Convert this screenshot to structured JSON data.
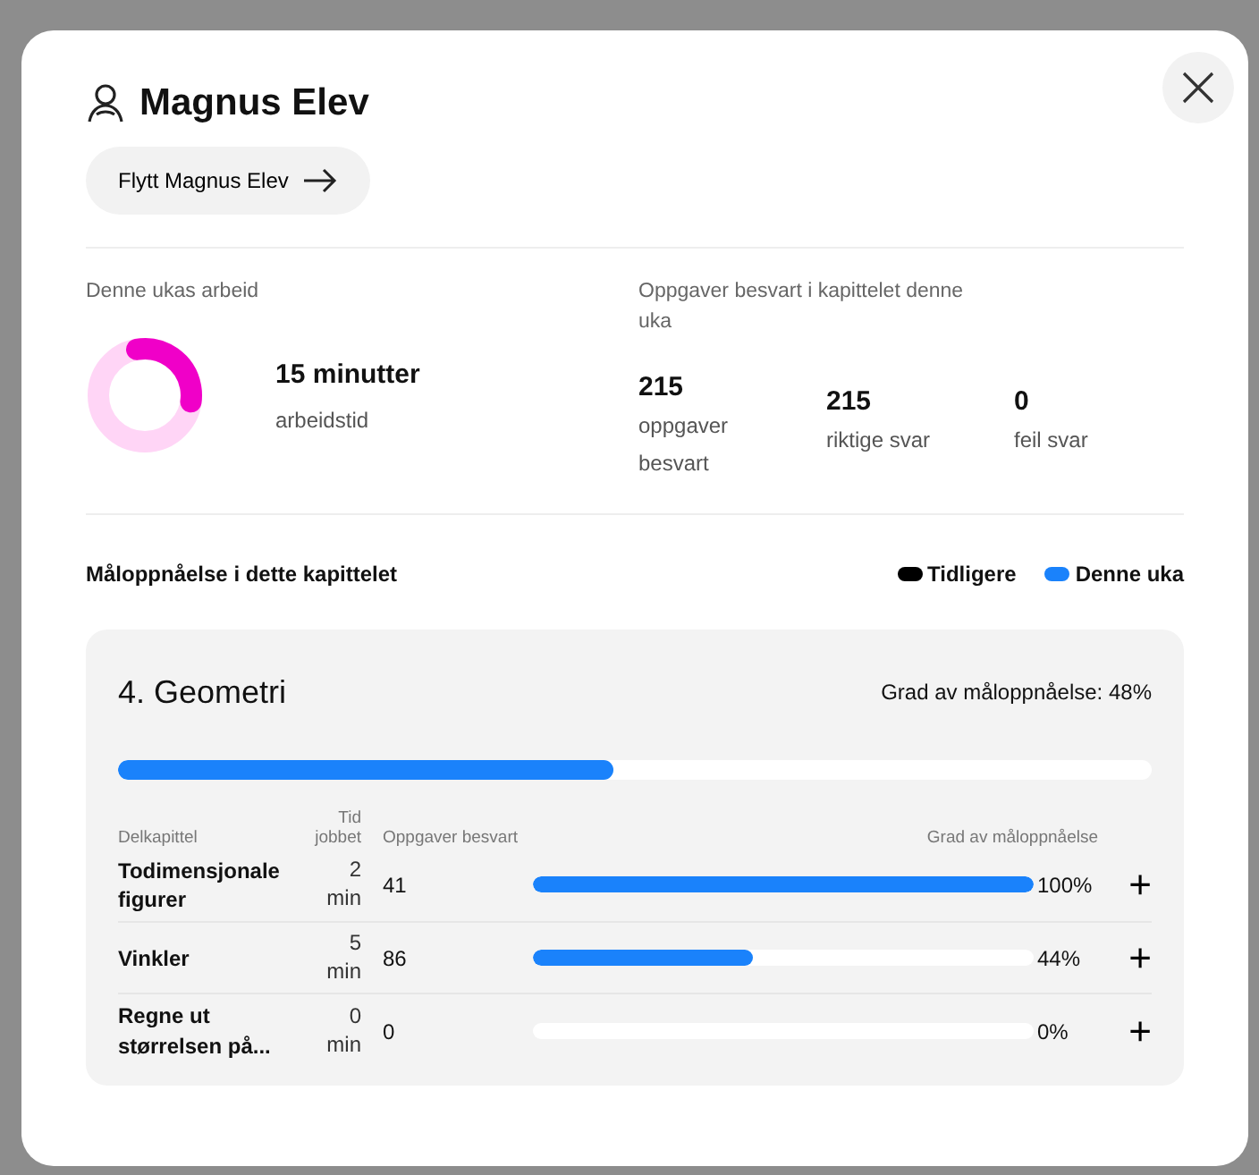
{
  "student": {
    "name": "Magnus Elev",
    "move_button": "Flytt Magnus Elev"
  },
  "week_work": {
    "heading": "Denne ukas arbeid",
    "level": 0.3,
    "value": "15 minutter",
    "label": "arbeidstid"
  },
  "answered": {
    "heading": "Oppgaver besvart i kapittelet denne uka",
    "stats": [
      {
        "value": "215",
        "label": "oppgaver besvart"
      },
      {
        "value": "215",
        "label": "riktige svar"
      },
      {
        "value": "0",
        "label": "feil svar"
      }
    ]
  },
  "goal_section": {
    "heading": "Måloppnåelse i dette kapittelet",
    "legend": [
      {
        "label": "Tidligere",
        "color": "#000000"
      },
      {
        "label": "Denne uka",
        "color": "#1a82fb"
      }
    ]
  },
  "chapter": {
    "title": "4. Geometri",
    "summary": "Grad av måloppnåelse: 48%",
    "level": 0.48,
    "columns": [
      "Delkapittel",
      "Tid jobbet",
      "Oppgaver besvart",
      "Grad av måloppnåelse"
    ],
    "rows": [
      {
        "name": "Todimensjonale figurer",
        "time": "2 min",
        "answered": "41",
        "level": 1,
        "percent": "100%",
        "expand": "+"
      },
      {
        "name": "Vinkler",
        "time": "5 min",
        "answered": "86",
        "level": 0.44,
        "percent": "44%",
        "expand": "+"
      },
      {
        "name": "Regne ut størrelsen på...",
        "time": "0 min",
        "answered": "0",
        "level": 0,
        "percent": "0%",
        "expand": "+"
      }
    ]
  }
}
